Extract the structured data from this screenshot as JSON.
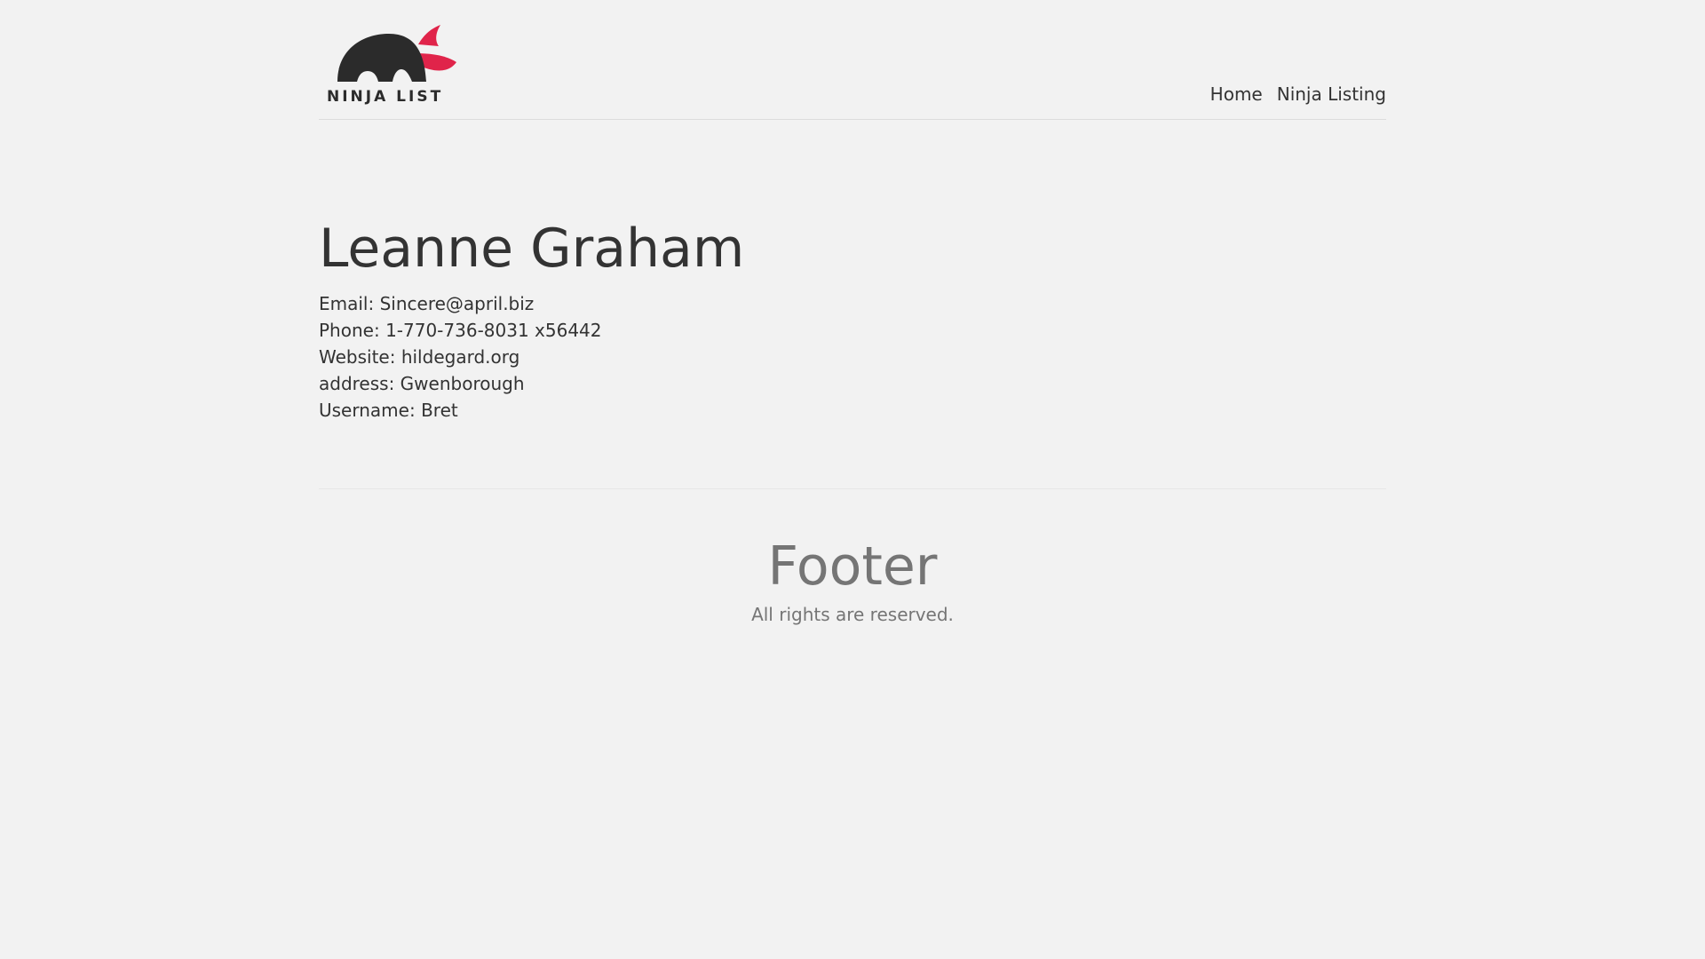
{
  "header": {
    "logo_text": "NINJA LIST",
    "nav": [
      {
        "label": "Home"
      },
      {
        "label": "Ninja Listing"
      }
    ]
  },
  "profile": {
    "name": "Leanne Graham",
    "email_label": "Email:",
    "email": "Sincere@april.biz",
    "phone_label": "Phone:",
    "phone": "1-770-736-8031 x56442",
    "website_label": "Website:",
    "website": "hildegard.org",
    "address_label": "address:",
    "address": "Gwenborough",
    "username_label": "Username:",
    "username": "Bret"
  },
  "footer": {
    "title": "Footer",
    "note": "All rights are reserved."
  },
  "colors": {
    "background": "#f2f2f2",
    "text": "#333333",
    "muted": "#757575",
    "logo_dark": "#2b2b2b",
    "logo_accent": "#e0244a"
  },
  "icons": {
    "logo": "ninja-logo-icon"
  }
}
